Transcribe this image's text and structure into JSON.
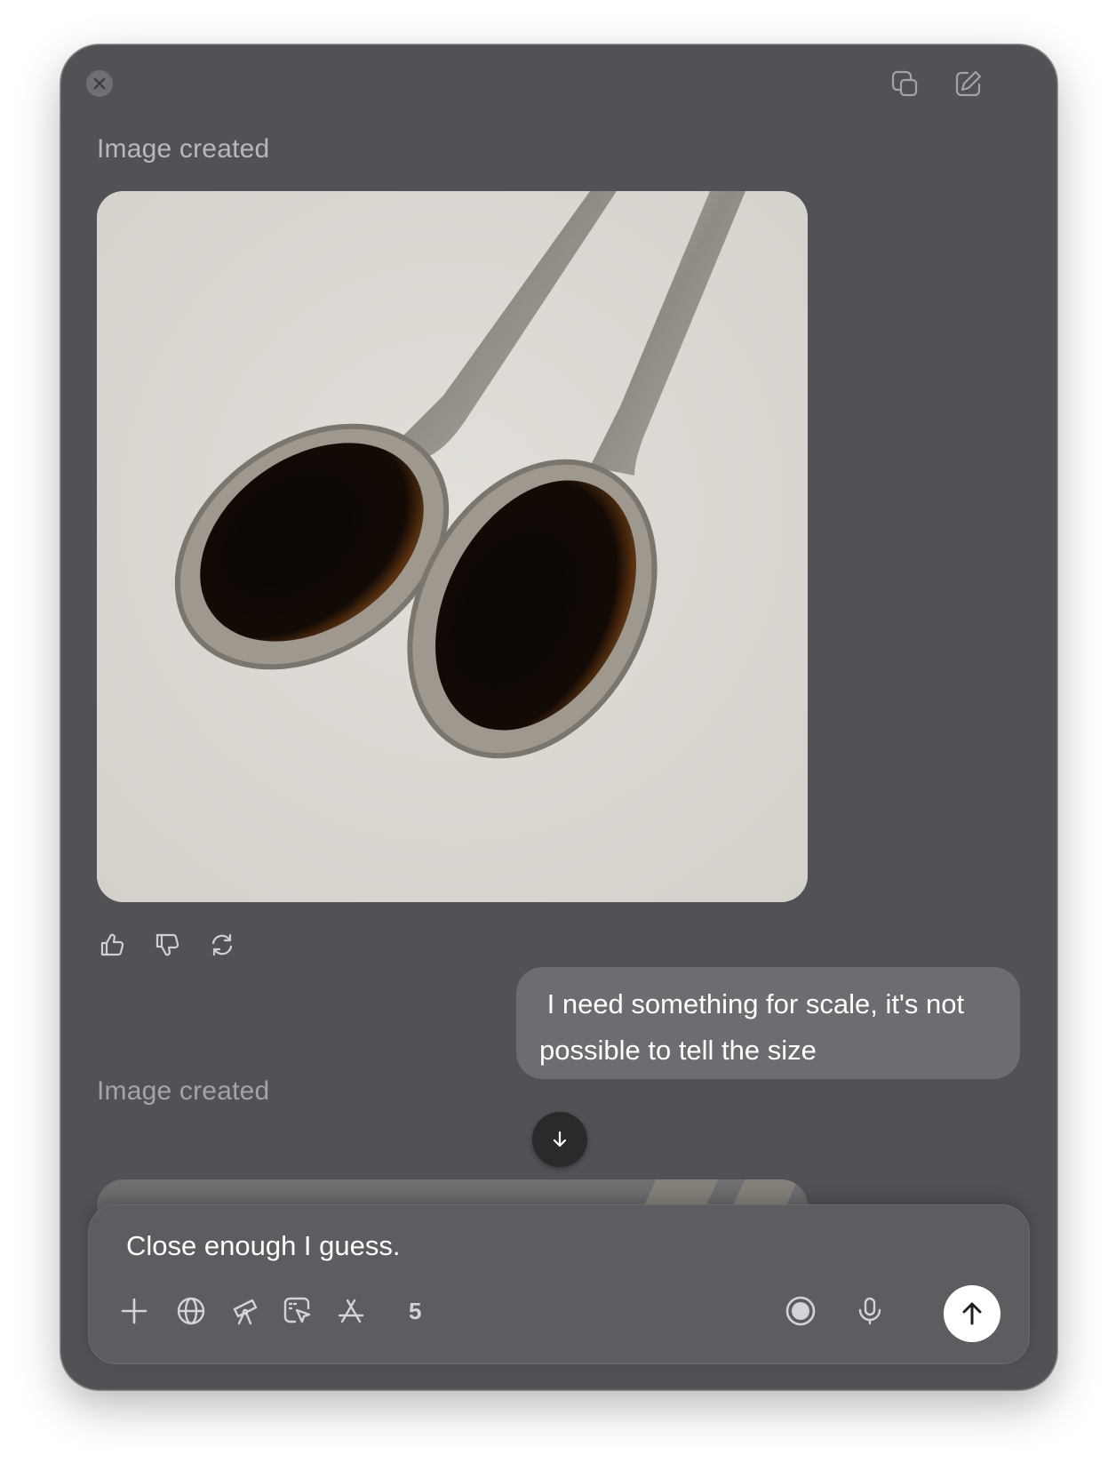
{
  "header": {
    "close_icon": "close-icon",
    "copy_icon": "copy-window-icon",
    "new_chat_icon": "compose-icon"
  },
  "messages": [
    {
      "role": "assistant",
      "label": "Image created",
      "image_description_icon": "image",
      "actions": [
        "thumbs-up-icon",
        "thumbs-down-icon",
        "regenerate-icon"
      ]
    },
    {
      "role": "user",
      "line1": " I need something for scale, it's not",
      "line2": "possible to tell the size"
    },
    {
      "role": "assistant",
      "label": "Image created"
    }
  ],
  "scroll_button_icon": "arrow-down-icon",
  "composer": {
    "text": "Close enough I guess.",
    "tools": [
      "plus-icon",
      "globe-icon",
      "telescope-icon",
      "select-pointer-icon",
      "app-store-icon"
    ],
    "tools_count": "5",
    "right_icons": [
      "voice-mode-icon",
      "microphone-icon"
    ],
    "send_icon": "arrow-up-icon"
  },
  "colors": {
    "window_bg": "#515156",
    "bubble_bg": "#6c6c71",
    "composer_bg": "#5c5c61",
    "text_muted": "#b7b7bc"
  }
}
